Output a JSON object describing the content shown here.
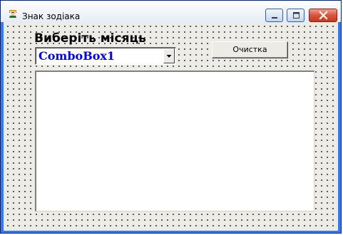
{
  "window": {
    "title": "Знак зодіака",
    "controls": {
      "minimize": "minimize-icon",
      "maximize": "maximize-icon",
      "close": "close-icon"
    }
  },
  "form": {
    "month_label": "Виберіть місяць",
    "combo": {
      "value": "ComboBox1",
      "arrow_icon": "chevron-down-icon"
    },
    "clear_button": "Очистка",
    "memo_text": ""
  },
  "colors": {
    "combo_text": "#0000ee",
    "close_button": "#d9533a",
    "window_border": "#0a246a"
  }
}
